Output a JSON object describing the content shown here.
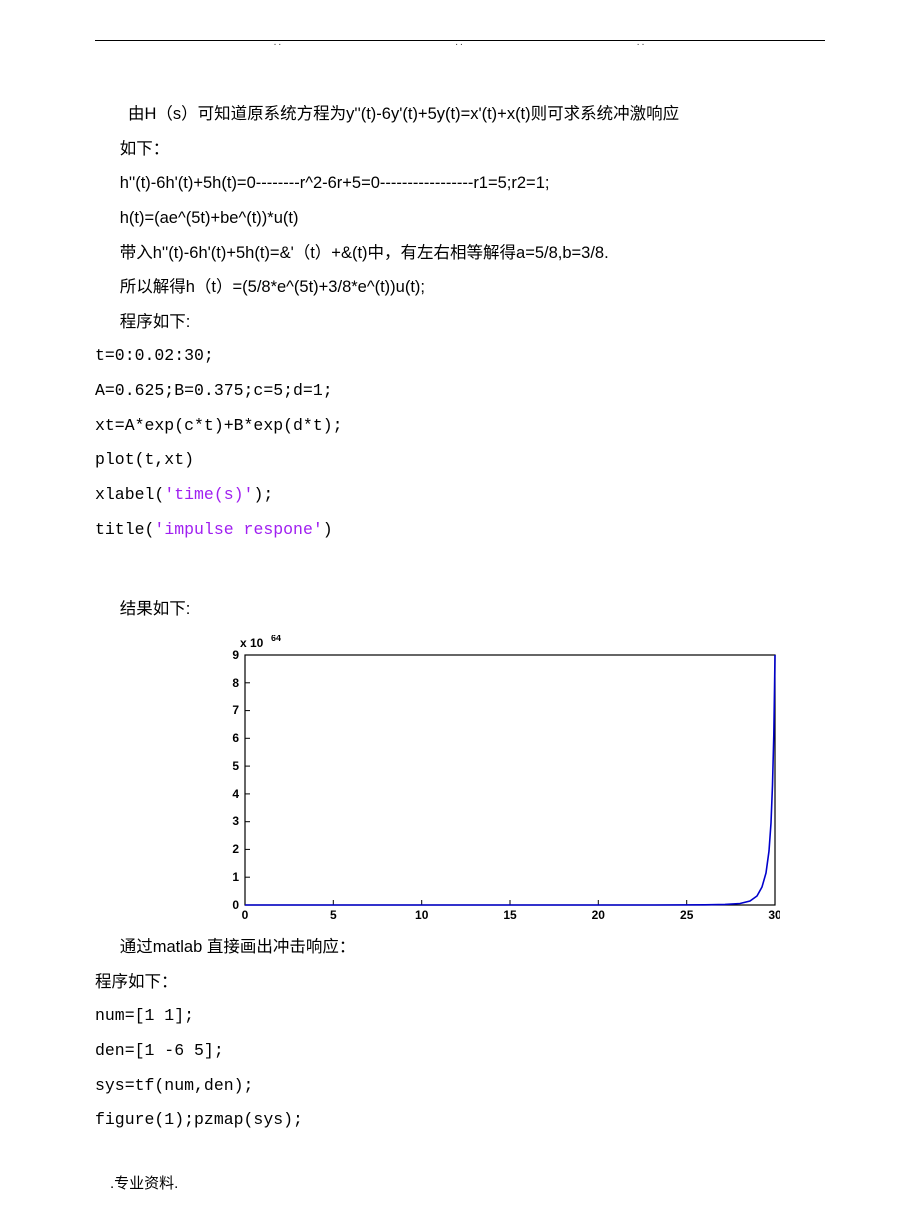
{
  "para1": "由H（s）可知道原系统方程为y''(t)-6y'(t)+5y(t)=x'(t)+x(t)则可求系统冲激响应",
  "para2": "如下：",
  "para3": "h''(t)-6h'(t)+5h(t)=0--------r^2-6r+5=0-----------------r1=5;r2=1;",
  "para4": "h(t)=(ae^(5t)+be^(t))*u(t)",
  "para5": "带入h''(t)-6h'(t)+5h(t)=&'（t）+&(t)中，有左右相等解得a=5/8,b=3/8.",
  "para6": "所以解得h（t）=(5/8*e^(5t)+3/8*e^(t))u(t);",
  "para7": "程序如下:",
  "code1": "t=0:0.02:30;",
  "code2": "A=0.625;B=0.375;c=5;d=1;",
  "code3": "xt=A*exp(c*t)+B*exp(d*t);",
  "code4": "plot(t,xt)",
  "code5a": "xlabel(",
  "code5b": "'time(s)'",
  "code5c": ");",
  "code6a": "title(",
  "code6b": "'impulse respone'",
  "code6c": ")",
  "result_label": "结果如下:",
  "para8": "通过matlab 直接画出冲击响应：",
  "para9": "程序如下：",
  "code7": "num=[1 1];",
  "code8": "den=[1 -6 5];",
  "code9": "sys=tf(num,den);",
  "code10": "figure(1);pzmap(sys);",
  "footer": ".专业资料.",
  "chart_data": {
    "type": "line",
    "title": "",
    "xlabel": "",
    "ylabel": "",
    "y_exponent_label": "x 10^64",
    "xlim": [
      0,
      30
    ],
    "ylim": [
      0,
      9e+64
    ],
    "x_ticks": [
      0,
      5,
      10,
      15,
      20,
      25,
      30
    ],
    "y_ticks": [
      0,
      1,
      2,
      3,
      4,
      5,
      6,
      7,
      8,
      9
    ],
    "series": [
      {
        "name": "xt",
        "color": "#0000cc",
        "x": [
          0,
          5,
          10,
          15,
          20,
          22,
          24,
          26,
          27,
          28,
          28.5,
          29,
          29.2,
          29.4,
          29.6,
          29.8,
          30
        ],
        "y": [
          0,
          0,
          0,
          0,
          0,
          0,
          0,
          0,
          0,
          2e+62,
          7e+62,
          3e+63,
          6e+63,
          1.3e+64,
          2.8e+64,
          6e+64,
          9e+64
        ]
      }
    ]
  }
}
